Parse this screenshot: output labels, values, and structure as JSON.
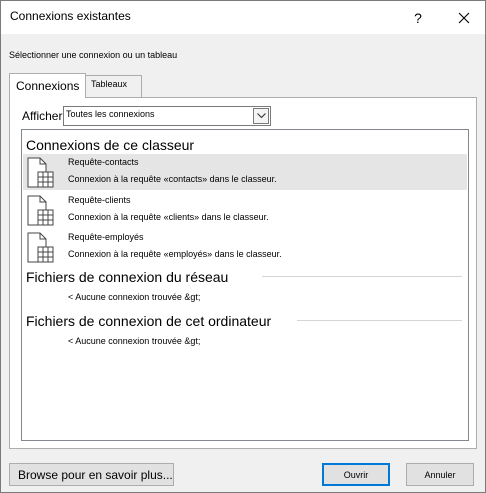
{
  "window": {
    "title": "Connexions existantes",
    "help_label": "?"
  },
  "subtitle": "Sélectionner une connexion ou un tableau",
  "tabs": [
    {
      "label": "Connexions",
      "active": true
    },
    {
      "label": "Tableaux",
      "active": false
    }
  ],
  "filter": {
    "label": "Afficher",
    "value": "Toutes les connexions"
  },
  "sections": {
    "workbook": {
      "title": "Connexions de ce classeur",
      "items": [
        {
          "name": "Requête-contacts",
          "description": "Connexion à la requête «contacts» dans le classeur.",
          "selected": true
        },
        {
          "name": "Requête-clients",
          "description": "Connexion à la requête «clients» dans le classeur.",
          "selected": false
        },
        {
          "name": "Requête-employés",
          "description": "Connexion à la requête «employés» dans le classeur.",
          "selected": false
        }
      ]
    },
    "network": {
      "title": "Fichiers de connexion du réseau",
      "empty": "< Aucune connexion trouvée &gt;"
    },
    "computer": {
      "title": "Fichiers de connexion de cet ordinateur",
      "empty": "< Aucune connexion trouvée &gt;"
    }
  },
  "buttons": {
    "browse": "Browse pour en savoir plus...",
    "open": "Ouvrir",
    "cancel": "Annuler"
  },
  "icons": {
    "close": "close-icon",
    "dropdown": "chevron-down-icon",
    "connection": "table-connection-icon"
  },
  "colors": {
    "selected_row": "#e5e5e5",
    "default_button_border": "#0078d7",
    "dialog_bg": "#f0f0f0"
  }
}
